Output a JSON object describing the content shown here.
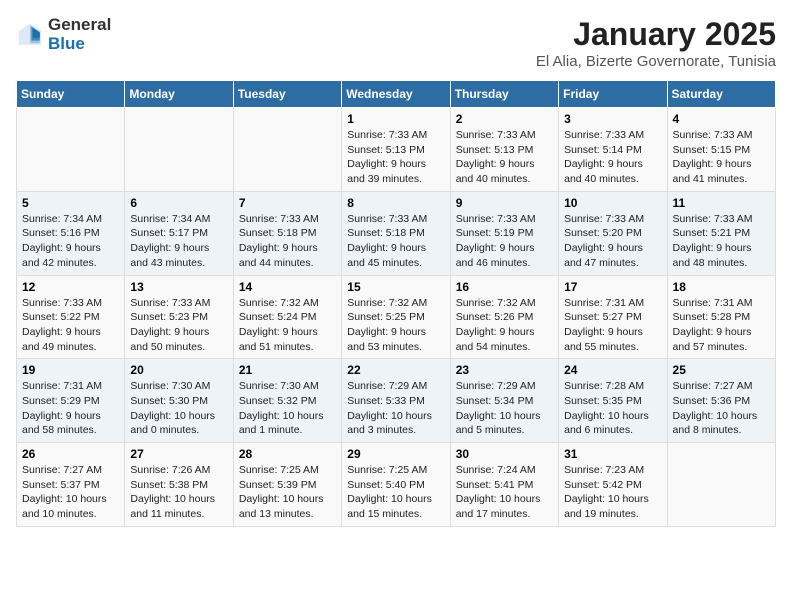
{
  "logo": {
    "general": "General",
    "blue": "Blue"
  },
  "title": "January 2025",
  "subtitle": "El Alia, Bizerte Governorate, Tunisia",
  "weekdays": [
    "Sunday",
    "Monday",
    "Tuesday",
    "Wednesday",
    "Thursday",
    "Friday",
    "Saturday"
  ],
  "weeks": [
    [
      {
        "day": "",
        "info": ""
      },
      {
        "day": "",
        "info": ""
      },
      {
        "day": "",
        "info": ""
      },
      {
        "day": "1",
        "info": "Sunrise: 7:33 AM\nSunset: 5:13 PM\nDaylight: 9 hours\nand 39 minutes."
      },
      {
        "day": "2",
        "info": "Sunrise: 7:33 AM\nSunset: 5:13 PM\nDaylight: 9 hours\nand 40 minutes."
      },
      {
        "day": "3",
        "info": "Sunrise: 7:33 AM\nSunset: 5:14 PM\nDaylight: 9 hours\nand 40 minutes."
      },
      {
        "day": "4",
        "info": "Sunrise: 7:33 AM\nSunset: 5:15 PM\nDaylight: 9 hours\nand 41 minutes."
      }
    ],
    [
      {
        "day": "5",
        "info": "Sunrise: 7:34 AM\nSunset: 5:16 PM\nDaylight: 9 hours\nand 42 minutes."
      },
      {
        "day": "6",
        "info": "Sunrise: 7:34 AM\nSunset: 5:17 PM\nDaylight: 9 hours\nand 43 minutes."
      },
      {
        "day": "7",
        "info": "Sunrise: 7:33 AM\nSunset: 5:18 PM\nDaylight: 9 hours\nand 44 minutes."
      },
      {
        "day": "8",
        "info": "Sunrise: 7:33 AM\nSunset: 5:18 PM\nDaylight: 9 hours\nand 45 minutes."
      },
      {
        "day": "9",
        "info": "Sunrise: 7:33 AM\nSunset: 5:19 PM\nDaylight: 9 hours\nand 46 minutes."
      },
      {
        "day": "10",
        "info": "Sunrise: 7:33 AM\nSunset: 5:20 PM\nDaylight: 9 hours\nand 47 minutes."
      },
      {
        "day": "11",
        "info": "Sunrise: 7:33 AM\nSunset: 5:21 PM\nDaylight: 9 hours\nand 48 minutes."
      }
    ],
    [
      {
        "day": "12",
        "info": "Sunrise: 7:33 AM\nSunset: 5:22 PM\nDaylight: 9 hours\nand 49 minutes."
      },
      {
        "day": "13",
        "info": "Sunrise: 7:33 AM\nSunset: 5:23 PM\nDaylight: 9 hours\nand 50 minutes."
      },
      {
        "day": "14",
        "info": "Sunrise: 7:32 AM\nSunset: 5:24 PM\nDaylight: 9 hours\nand 51 minutes."
      },
      {
        "day": "15",
        "info": "Sunrise: 7:32 AM\nSunset: 5:25 PM\nDaylight: 9 hours\nand 53 minutes."
      },
      {
        "day": "16",
        "info": "Sunrise: 7:32 AM\nSunset: 5:26 PM\nDaylight: 9 hours\nand 54 minutes."
      },
      {
        "day": "17",
        "info": "Sunrise: 7:31 AM\nSunset: 5:27 PM\nDaylight: 9 hours\nand 55 minutes."
      },
      {
        "day": "18",
        "info": "Sunrise: 7:31 AM\nSunset: 5:28 PM\nDaylight: 9 hours\nand 57 minutes."
      }
    ],
    [
      {
        "day": "19",
        "info": "Sunrise: 7:31 AM\nSunset: 5:29 PM\nDaylight: 9 hours\nand 58 minutes."
      },
      {
        "day": "20",
        "info": "Sunrise: 7:30 AM\nSunset: 5:30 PM\nDaylight: 10 hours\nand 0 minutes."
      },
      {
        "day": "21",
        "info": "Sunrise: 7:30 AM\nSunset: 5:32 PM\nDaylight: 10 hours\nand 1 minute."
      },
      {
        "day": "22",
        "info": "Sunrise: 7:29 AM\nSunset: 5:33 PM\nDaylight: 10 hours\nand 3 minutes."
      },
      {
        "day": "23",
        "info": "Sunrise: 7:29 AM\nSunset: 5:34 PM\nDaylight: 10 hours\nand 5 minutes."
      },
      {
        "day": "24",
        "info": "Sunrise: 7:28 AM\nSunset: 5:35 PM\nDaylight: 10 hours\nand 6 minutes."
      },
      {
        "day": "25",
        "info": "Sunrise: 7:27 AM\nSunset: 5:36 PM\nDaylight: 10 hours\nand 8 minutes."
      }
    ],
    [
      {
        "day": "26",
        "info": "Sunrise: 7:27 AM\nSunset: 5:37 PM\nDaylight: 10 hours\nand 10 minutes."
      },
      {
        "day": "27",
        "info": "Sunrise: 7:26 AM\nSunset: 5:38 PM\nDaylight: 10 hours\nand 11 minutes."
      },
      {
        "day": "28",
        "info": "Sunrise: 7:25 AM\nSunset: 5:39 PM\nDaylight: 10 hours\nand 13 minutes."
      },
      {
        "day": "29",
        "info": "Sunrise: 7:25 AM\nSunset: 5:40 PM\nDaylight: 10 hours\nand 15 minutes."
      },
      {
        "day": "30",
        "info": "Sunrise: 7:24 AM\nSunset: 5:41 PM\nDaylight: 10 hours\nand 17 minutes."
      },
      {
        "day": "31",
        "info": "Sunrise: 7:23 AM\nSunset: 5:42 PM\nDaylight: 10 hours\nand 19 minutes."
      },
      {
        "day": "",
        "info": ""
      }
    ]
  ]
}
